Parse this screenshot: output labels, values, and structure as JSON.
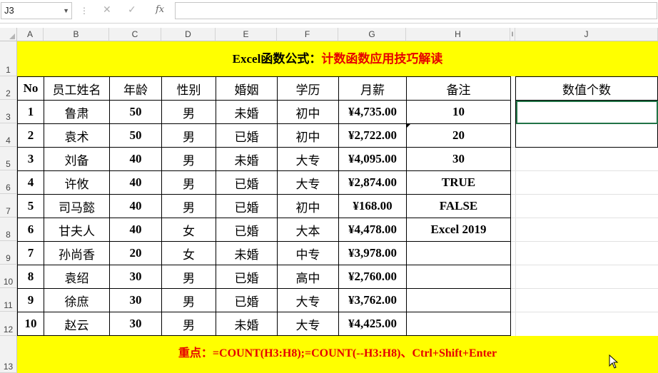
{
  "formula_bar": {
    "name_box": "J3",
    "formula": ""
  },
  "columns": [
    "A",
    "B",
    "C",
    "D",
    "E",
    "F",
    "G",
    "H",
    "I",
    "J"
  ],
  "rows": [
    "1",
    "2",
    "3",
    "4",
    "5",
    "6",
    "7",
    "8",
    "9",
    "10",
    "11",
    "12",
    "13"
  ],
  "title": {
    "black": "Excel函数公式：",
    "red": "计数函数应用技巧解读"
  },
  "headers": [
    "No",
    "员工姓名",
    "年龄",
    "性别",
    "婚姻",
    "学历",
    "月薪",
    "备注"
  ],
  "records": [
    [
      "1",
      "鲁肃",
      "50",
      "男",
      "未婚",
      "初中",
      "¥4,735.00",
      "10"
    ],
    [
      "2",
      "袁术",
      "50",
      "男",
      "已婚",
      "初中",
      "¥2,722.00",
      "20"
    ],
    [
      "3",
      "刘备",
      "40",
      "男",
      "未婚",
      "大专",
      "¥4,095.00",
      "30"
    ],
    [
      "4",
      "许攸",
      "40",
      "男",
      "已婚",
      "大专",
      "¥2,874.00",
      "TRUE"
    ],
    [
      "5",
      "司马懿",
      "40",
      "男",
      "已婚",
      "初中",
      "¥168.00",
      "FALSE"
    ],
    [
      "6",
      "甘夫人",
      "40",
      "女",
      "已婚",
      "大本",
      "¥4,478.00",
      "Excel 2019"
    ],
    [
      "7",
      "孙尚香",
      "20",
      "女",
      "未婚",
      "中专",
      "¥3,978.00",
      ""
    ],
    [
      "8",
      "袁绍",
      "30",
      "男",
      "已婚",
      "高中",
      "¥2,760.00",
      ""
    ],
    [
      "9",
      "徐庶",
      "30",
      "男",
      "已婚",
      "大专",
      "¥3,762.00",
      ""
    ],
    [
      "10",
      "赵云",
      "30",
      "男",
      "未婚",
      "大专",
      "¥4,425.00",
      ""
    ]
  ],
  "side": {
    "header": "数值个数",
    "values": [
      "",
      ""
    ]
  },
  "footer": {
    "label": "重点：",
    "formula": "=COUNT(H3:H8);=COUNT(--H3:H8)、Ctrl+Shift+Enter"
  }
}
